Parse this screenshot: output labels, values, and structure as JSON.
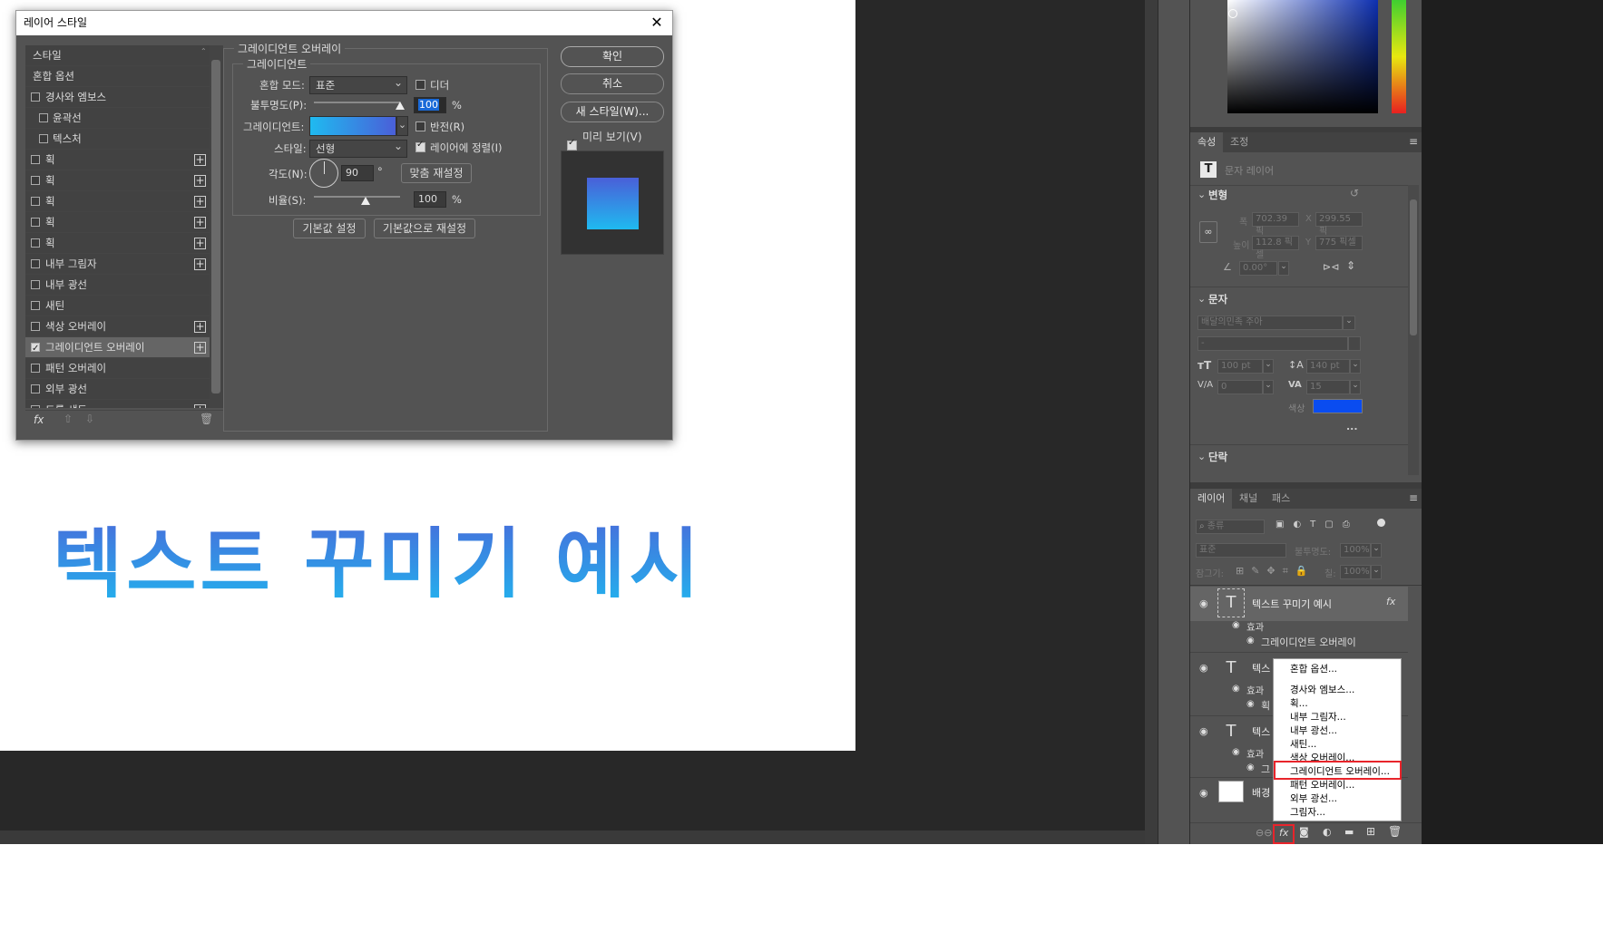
{
  "document": {
    "canvas_text": "텍스트 꾸미기 예시"
  },
  "dialog": {
    "title": "레이어 스타일",
    "styles_list": [
      {
        "label": "스타일",
        "type": "header"
      },
      {
        "label": "혼합 옵션",
        "type": "header"
      },
      {
        "label": "경사와 엠보스",
        "type": "check",
        "checked": false
      },
      {
        "label": "윤곽선",
        "type": "subcheck",
        "checked": false
      },
      {
        "label": "텍스처",
        "type": "subcheck",
        "checked": false
      },
      {
        "label": "획",
        "type": "check",
        "checked": false,
        "plus": true
      },
      {
        "label": "획",
        "type": "check",
        "checked": false,
        "plus": true
      },
      {
        "label": "획",
        "type": "check",
        "checked": false,
        "plus": true
      },
      {
        "label": "획",
        "type": "check",
        "checked": false,
        "plus": true
      },
      {
        "label": "획",
        "type": "check",
        "checked": false,
        "plus": true
      },
      {
        "label": "내부 그림자",
        "type": "check",
        "checked": false,
        "plus": true
      },
      {
        "label": "내부 광선",
        "type": "check",
        "checked": false
      },
      {
        "label": "새틴",
        "type": "check",
        "checked": false
      },
      {
        "label": "색상 오버레이",
        "type": "check",
        "checked": false,
        "plus": true
      },
      {
        "label": "그레이디언트 오버레이",
        "type": "check",
        "checked": true,
        "plus": true,
        "selected": true
      },
      {
        "label": "패턴 오버레이",
        "type": "check",
        "checked": false
      },
      {
        "label": "외부 광선",
        "type": "check",
        "checked": false
      },
      {
        "label": "드롭 섀도",
        "type": "check",
        "checked": false,
        "plus": true
      }
    ],
    "bottom_icons": {
      "fx": "fx"
    },
    "section_title": "그레이디언트 오버레이",
    "subsection_title": "그레이디언트",
    "blend_mode_label": "혼합 모드:",
    "blend_mode_value": "표준",
    "dither_label": "디더",
    "dither_checked": false,
    "opacity_label": "불투명도(P):",
    "opacity_value": "100",
    "opacity_fraction": 1.0,
    "percent": "%",
    "gradient_label": "그레이디언트:",
    "reverse_label": "반전(R)",
    "reverse_checked": false,
    "style_label": "스타일:",
    "style_value": "선형",
    "align_label": "레이어에 정렬(I)",
    "align_checked": true,
    "angle_label": "각도(N):",
    "angle_value": "90",
    "degree": "°",
    "reset_align_label": "맞춤 재설정",
    "scale_label": "비율(S):",
    "scale_value": "100",
    "scale_fraction": 0.6,
    "make_default_label": "기본값 설정",
    "reset_default_label": "기본값으로 재설정",
    "ok_label": "확인",
    "cancel_label": "취소",
    "new_style_label": "새 스타일(W)...",
    "preview_label": "미리 보기(V)",
    "preview_checked": true,
    "gradient_colors": [
      "#1fbaf0",
      "#4a5fd8"
    ]
  },
  "properties_panel": {
    "tabs": [
      "속성",
      "조정"
    ],
    "layer_kind": "문자 레이어",
    "transform_header": "변형",
    "w_label": "폭",
    "w_value": "702.39 픽",
    "x_label": "X",
    "x_value": "299.55 픽",
    "h_label": "높이",
    "h_value": "112.8 픽셀",
    "y_label": "Y",
    "y_value": "775 픽셀",
    "angle_value": "0.00°",
    "character_header": "문자",
    "font_value": "배달의민족 주아",
    "font_style_value": "-",
    "size_value": "100 pt",
    "leading_value": "140 pt",
    "kerning_value": "0",
    "tracking_value": "15",
    "color_label": "색상",
    "color_swatch": "#0a4cf0",
    "more": "...",
    "paragraph_header": "단락"
  },
  "layers_panel": {
    "tabs": [
      "레이어",
      "채널",
      "패스"
    ],
    "filter_placeholder": "종류",
    "blend_value": "표준",
    "opacity_label": "불투명도:",
    "opacity_value": "100%",
    "lock_label": "잠그기:",
    "fill_label": "칠:",
    "fill_value": "100%",
    "layers": [
      {
        "name": "텍스트 꾸미기 예시",
        "effects_label": "효과",
        "effect": "그레이디언트 오버레이"
      },
      {
        "name": "텍스",
        "effects_label": "효과",
        "effect": "획"
      },
      {
        "name": "텍스",
        "effects_label": "효과",
        "effect": "그"
      },
      {
        "name": "배경"
      }
    ],
    "fx_label": "fx"
  },
  "context_menu": {
    "items": [
      "혼합 옵션...",
      "경사와 엠보스...",
      "획...",
      "내부 그림자...",
      "내부 광선...",
      "새틴...",
      "색상 오버레이...",
      "그레이디언트 오버레이...",
      "패턴 오버레이...",
      "외부 광선...",
      "그림자..."
    ],
    "highlighted_index": 7
  }
}
